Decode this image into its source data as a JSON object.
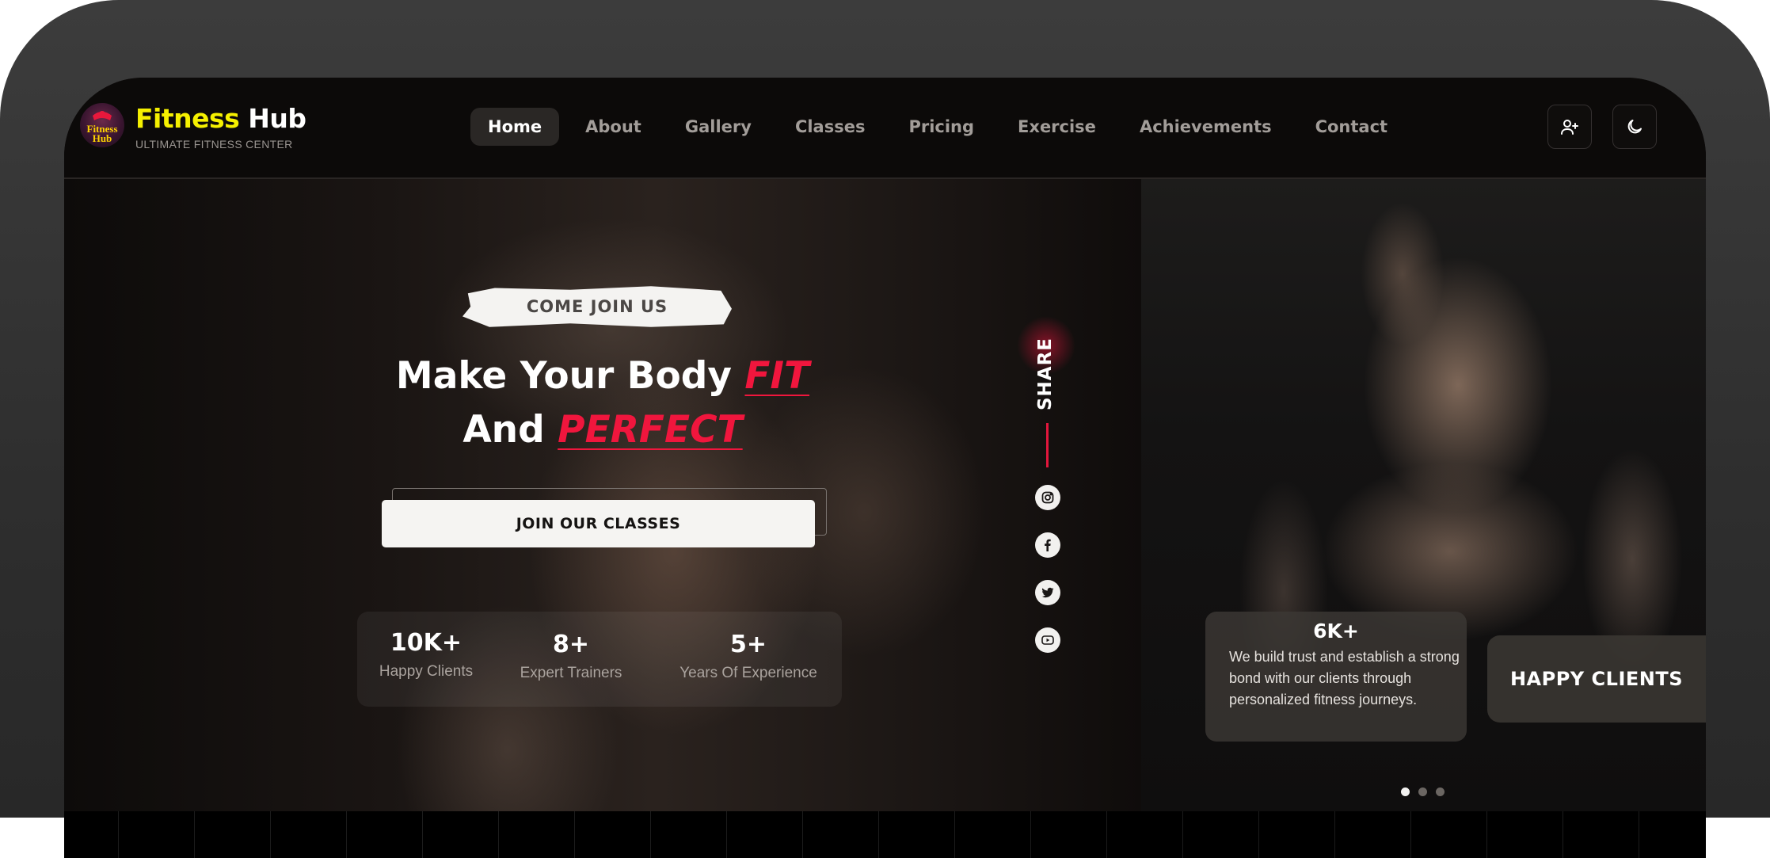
{
  "brand": {
    "logo_text": "Fitness Hub",
    "name_part1": "Fitness",
    "name_part2": "Hub",
    "tagline": "ULTIMATE FITNESS CENTER"
  },
  "nav": [
    {
      "label": "Home",
      "active": true
    },
    {
      "label": "About",
      "active": false
    },
    {
      "label": "Gallery",
      "active": false
    },
    {
      "label": "Classes",
      "active": false
    },
    {
      "label": "Pricing",
      "active": false
    },
    {
      "label": "Exercise",
      "active": false
    },
    {
      "label": "Achievements",
      "active": false
    },
    {
      "label": "Contact",
      "active": false
    }
  ],
  "header_actions": [
    {
      "icon": "add-user-icon"
    },
    {
      "icon": "moon-icon"
    }
  ],
  "hero": {
    "badge": "COME JOIN US",
    "headline_line1": "Make Your Body",
    "headline_highlight1": "FIT",
    "headline_line2": "And",
    "headline_highlight2": "PERFECT",
    "cta": "JOIN OUR CLASSES",
    "stats": [
      {
        "value": "10K+",
        "label": "Happy Clients"
      },
      {
        "value": "8+",
        "label": "Expert Trainers"
      },
      {
        "value": "5+",
        "label": "Years Of Experience"
      }
    ]
  },
  "share": {
    "label": "SHARE",
    "icons": [
      "instagram-icon",
      "facebook-icon",
      "twitter-icon",
      "youtube-icon"
    ]
  },
  "testimonial": {
    "value": "6K+",
    "description": "We build trust and establish a strong bond with our clients through personalized fitness journeys.",
    "label": "HAPPY CLIENTS"
  },
  "carousel": {
    "count": 3,
    "active_index": 0
  },
  "colors": {
    "accent": "#f0163d",
    "brand_yellow": "#f5f000",
    "background": "#0c0a09"
  }
}
